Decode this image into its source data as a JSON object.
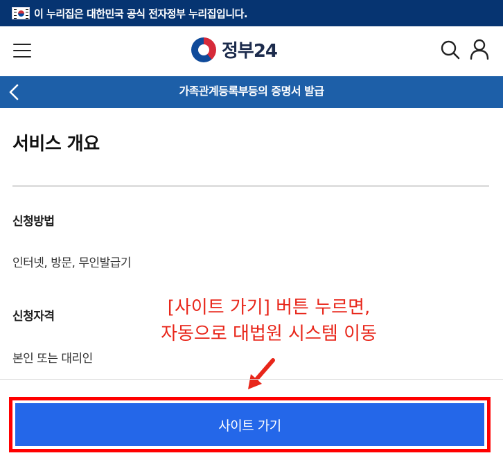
{
  "gov_banner": {
    "text": "이 누리집은 대한민국 공식 전자정부 누리집입니다.",
    "flag_icon": "korea-flag-icon"
  },
  "header": {
    "logo_text": "정부24",
    "menu_icon": "hamburger-menu-icon",
    "search_icon": "search-icon",
    "user_icon": "user-icon"
  },
  "titlebar": {
    "title": "가족관계등록부등의 증명서 발급",
    "back_icon": "chevron-left-icon"
  },
  "overview": {
    "title": "서비스 개요",
    "fields": [
      {
        "label": "신청방법",
        "value": "인터넷, 방문, 무인발급기"
      },
      {
        "label": "신청자격",
        "value": "본인 또는 대리인"
      }
    ]
  },
  "annotation": {
    "line1": "[사이트 가기] 버튼 누르면,",
    "line2": "자동으로 대법원 시스템 이동"
  },
  "cta": {
    "label": "사이트 가기"
  },
  "colors": {
    "banner": "#063471",
    "titlebar": "#1d5fa8",
    "button": "#2467e9",
    "annotation": "#e8261a",
    "highlight": "#ff0000"
  }
}
